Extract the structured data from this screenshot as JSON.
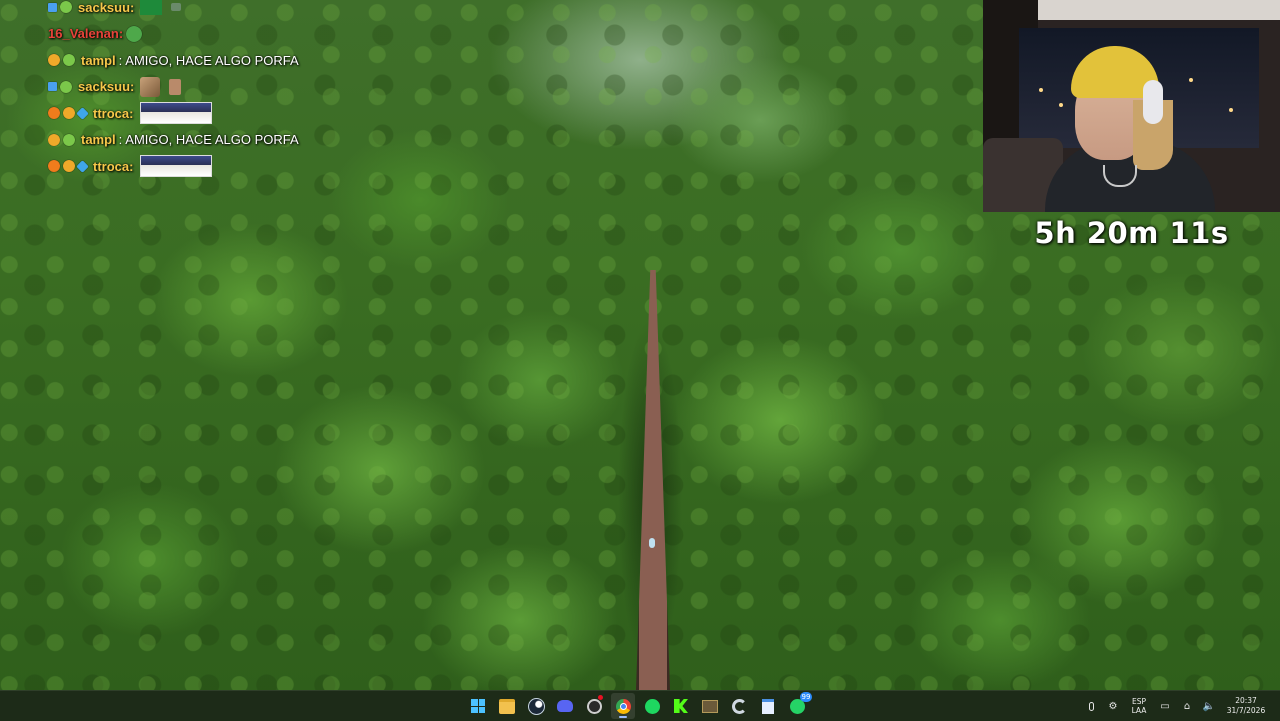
{
  "chat": {
    "messages": [
      {
        "badges": [
          "sword",
          "green"
        ],
        "user": "sacksuu:",
        "user_color": "#f6c84a",
        "text": "",
        "emote": "green-emote"
      },
      {
        "badges": [],
        "user": "16_Valenan:",
        "user_color": "#e8433a",
        "text": "",
        "emote": ""
      },
      {
        "badges": [
          "gold",
          "green"
        ],
        "user": "tampl",
        "user_color": "#f6c84a",
        "separator": ":",
        "text": "AMIGO, HACE ALGO PORFA",
        "emote": ""
      },
      {
        "badges": [
          "sword",
          "green"
        ],
        "user": "sacksuu:",
        "user_color": "#f6c84a",
        "text": "",
        "emote": "small-emote"
      },
      {
        "badges": [
          "orange",
          "gold",
          "blue"
        ],
        "user": "ttroca:",
        "user_color": "#f6c84a",
        "text": "",
        "emote": "face-emote"
      },
      {
        "badges": [
          "gold",
          "green"
        ],
        "user": "tampl",
        "user_color": "#f6c84a",
        "separator": ":",
        "text": "AMIGO, HACE ALGO PORFA",
        "emote": ""
      },
      {
        "badges": [
          "orange",
          "gold",
          "blue"
        ],
        "user": "ttroca:",
        "user_color": "#f6c84a",
        "text": "",
        "emote": "face-emote"
      }
    ]
  },
  "stream": {
    "uptime": "5h 20m 11s"
  },
  "taskbar": {
    "apps": [
      {
        "name": "start",
        "icon": "windows-start-icon",
        "active": false
      },
      {
        "name": "file-explorer",
        "icon": "folder-icon",
        "active": false
      },
      {
        "name": "steam",
        "icon": "steam-icon",
        "active": false
      },
      {
        "name": "discord",
        "icon": "discord-icon",
        "active": false
      },
      {
        "name": "obs",
        "icon": "obs-icon",
        "active": false,
        "recording": true
      },
      {
        "name": "chrome",
        "icon": "chrome-icon",
        "active": true
      },
      {
        "name": "spotify",
        "icon": "spotify-icon",
        "active": false
      },
      {
        "name": "kick",
        "icon": "kick-icon",
        "active": false
      },
      {
        "name": "game",
        "icon": "game-icon",
        "active": false
      },
      {
        "name": "ccleaner",
        "icon": "ccleaner-icon",
        "active": false
      },
      {
        "name": "notepad",
        "icon": "notepad-icon",
        "active": false
      },
      {
        "name": "whatsapp",
        "icon": "whatsapp-icon",
        "active": false,
        "badge": "99"
      }
    ],
    "tray": {
      "language_top": "ESP",
      "language_bottom": "LAA",
      "time": "20:37",
      "date": "31/7/2026"
    }
  }
}
